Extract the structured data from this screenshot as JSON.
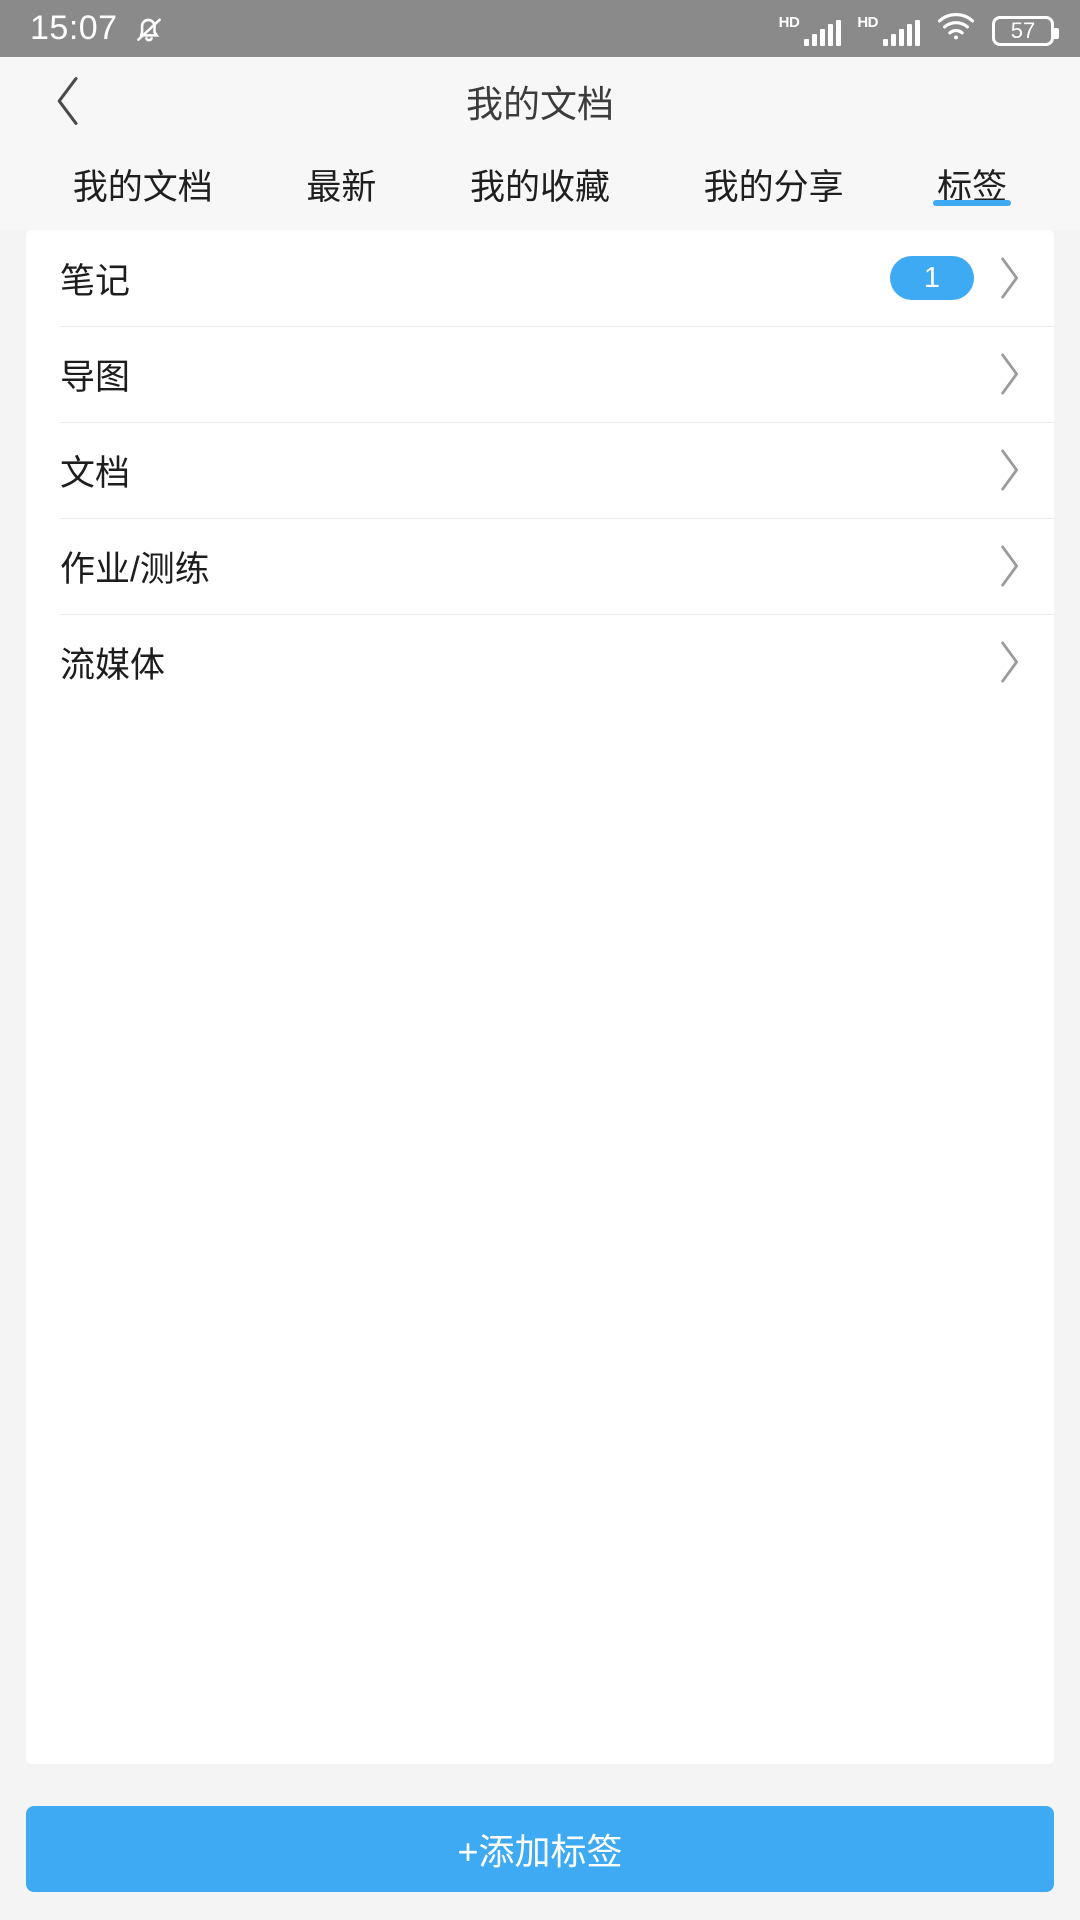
{
  "status_bar": {
    "time": "15:07",
    "mute_icon": "bell-mute-icon",
    "signal_1_label": "HD",
    "signal_2_label": "HD",
    "wifi_icon": "wifi-icon",
    "battery_level": "57"
  },
  "header": {
    "back_icon": "back-chevron-icon",
    "title": "我的文档"
  },
  "tabs": [
    {
      "label": "我的文档",
      "active": false
    },
    {
      "label": "最新",
      "active": false
    },
    {
      "label": "我的收藏",
      "active": false
    },
    {
      "label": "我的分享",
      "active": false
    },
    {
      "label": "标签",
      "active": true
    }
  ],
  "list": [
    {
      "label": "笔记",
      "badge": "1"
    },
    {
      "label": "导图",
      "badge": ""
    },
    {
      "label": "文档",
      "badge": ""
    },
    {
      "label": "作业/测练",
      "badge": ""
    },
    {
      "label": "流媒体",
      "badge": ""
    }
  ],
  "footer": {
    "add_button_label": "+添加标签"
  },
  "colors": {
    "accent": "#3daaf3",
    "statusbar_bg": "#8a8a8a",
    "page_bg": "#f4f4f4",
    "card_bg": "#ffffff",
    "text": "#1d1d1d"
  }
}
